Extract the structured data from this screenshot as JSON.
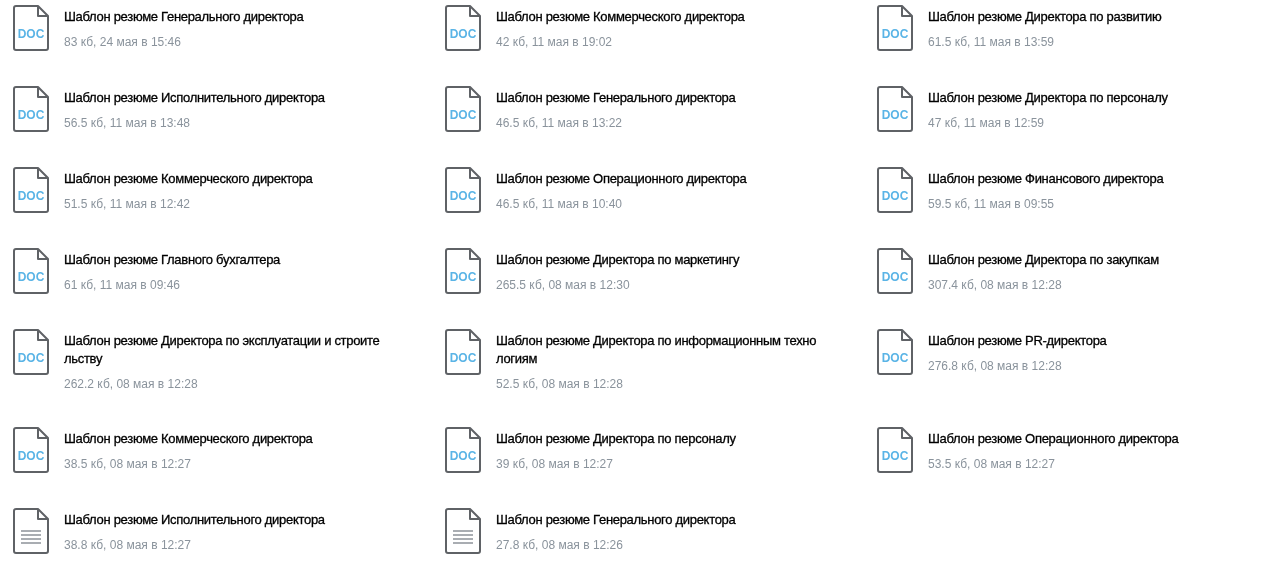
{
  "files": [
    {
      "kind": "doc",
      "badge": "DOC",
      "title_lines": [
        "Шаблон резюме Генерального директора"
      ],
      "meta": "83 кб, 24 мая в 15:46"
    },
    {
      "kind": "doc",
      "badge": "DOC",
      "title_lines": [
        "Шаблон резюме Коммерческого директора"
      ],
      "meta": "42 кб, 11 мая в 19:02"
    },
    {
      "kind": "doc",
      "badge": "DOC",
      "title_lines": [
        "Шаблон резюме Директора по развитию"
      ],
      "meta": "61.5 кб, 11 мая в 13:59"
    },
    {
      "kind": "doc",
      "badge": "DOC",
      "title_lines": [
        "Шаблон резюме Исполнительного директора"
      ],
      "meta": "56.5 кб, 11 мая в 13:48"
    },
    {
      "kind": "doc",
      "badge": "DOC",
      "title_lines": [
        "Шаблон резюме Генерального директора"
      ],
      "meta": "46.5 кб, 11 мая в 13:22"
    },
    {
      "kind": "doc",
      "badge": "DOC",
      "title_lines": [
        "Шаблон резюме Директора по персоналу"
      ],
      "meta": "47 кб, 11 мая в 12:59"
    },
    {
      "kind": "doc",
      "badge": "DOC",
      "title_lines": [
        "Шаблон резюме Коммерческого директора"
      ],
      "meta": "51.5 кб, 11 мая в 12:42"
    },
    {
      "kind": "doc",
      "badge": "DOC",
      "title_lines": [
        "Шаблон резюме Операционного директора"
      ],
      "meta": "46.5 кб, 11 мая в 10:40"
    },
    {
      "kind": "doc",
      "badge": "DOC",
      "title_lines": [
        "Шаблон резюме Финансового директора"
      ],
      "meta": "59.5 кб, 11 мая в 09:55"
    },
    {
      "kind": "doc",
      "badge": "DOC",
      "title_lines": [
        "Шаблон резюме Главного бухгалтера"
      ],
      "meta": "61 кб, 11 мая в 09:46"
    },
    {
      "kind": "doc",
      "badge": "DOC",
      "title_lines": [
        "Шаблон резюме Директора по маркетингу"
      ],
      "meta": "265.5 кб, 08 мая в 12:30"
    },
    {
      "kind": "doc",
      "badge": "DOC",
      "title_lines": [
        "Шаблон резюме Директора по закупкам"
      ],
      "meta": "307.4 кб, 08 мая в 12:28"
    },
    {
      "kind": "doc",
      "badge": "DOC",
      "title_lines": [
        "Шаблон резюме Директора по эксплуатации и строите",
        "льству"
      ],
      "meta": "262.2 кб, 08 мая в 12:28"
    },
    {
      "kind": "doc",
      "badge": "DOC",
      "title_lines": [
        "Шаблон резюме Директора по информационным техно",
        "логиям"
      ],
      "meta": "52.5 кб, 08 мая в 12:28"
    },
    {
      "kind": "doc",
      "badge": "DOC",
      "title_lines": [
        "Шаблон резюме PR-директора"
      ],
      "meta": "276.8 кб, 08 мая в 12:28"
    },
    {
      "kind": "doc",
      "badge": "DOC",
      "title_lines": [
        "Шаблон резюме Коммерческого директора"
      ],
      "meta": "38.5 кб, 08 мая в 12:27"
    },
    {
      "kind": "doc",
      "badge": "DOC",
      "title_lines": [
        "Шаблон резюме Директора по персоналу"
      ],
      "meta": "39 кб, 08 мая в 12:27"
    },
    {
      "kind": "doc",
      "badge": "DOC",
      "title_lines": [
        "Шаблон резюме Операционного директора"
      ],
      "meta": "53.5 кб, 08 мая в 12:27"
    },
    {
      "kind": "text",
      "title_lines": [
        "Шаблон резюме Исполнительного директора"
      ],
      "meta": "38.8 кб, 08 мая в 12:27"
    },
    {
      "kind": "text",
      "title_lines": [
        "Шаблон резюме Генерального директора"
      ],
      "meta": "27.8 кб, 08 мая в 12:26"
    }
  ]
}
